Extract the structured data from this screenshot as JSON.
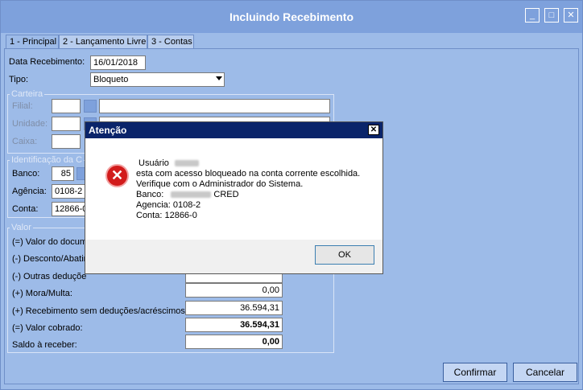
{
  "window": {
    "title": "Incluindo Recebimento",
    "minimize": "_",
    "maximize": "□",
    "close": "✕"
  },
  "tabs": [
    {
      "label": "1 - Principal"
    },
    {
      "label": "2 - Lançamento Livre"
    },
    {
      "label": "3 - Contas"
    }
  ],
  "form": {
    "data_recebimento_label": "Data Recebimento:",
    "data_recebimento_value": "16/01/2018",
    "tipo_label": "Tipo:",
    "tipo_value": "Bloqueto"
  },
  "carteira": {
    "legend": "Carteira",
    "filial_label": "Filial:",
    "unidade_label": "Unidade:",
    "caixa_label": "Caixa:"
  },
  "identificacao": {
    "legend": "Identificação da C",
    "banco_label": "Banco:",
    "banco_value": "85",
    "agencia_label": "Agência:",
    "agencia_value": "0108-2",
    "conta_label": "Conta:",
    "conta_value": "12866-0"
  },
  "valor": {
    "legend": "Valor",
    "rows": [
      {
        "label": "(=) Valor do docum",
        "value": ""
      },
      {
        "label": "(-) Desconto/Abatir",
        "value": ""
      },
      {
        "label": "(-) Outras deduçõe",
        "value": ""
      },
      {
        "label": "(+) Mora/Multa:",
        "value": "0,00"
      },
      {
        "label": "(+) Recebimento sem deduções/acréscimos:",
        "value": "36.594,31"
      },
      {
        "label": "(=) Valor cobrado:",
        "value": "36.594,31"
      },
      {
        "label": "Saldo à receber:",
        "value": "0,00"
      }
    ]
  },
  "buttons": {
    "confirmar": "Confirmar",
    "cancelar": "Cancelar"
  },
  "dialog": {
    "title": "Atenção",
    "close": "✕",
    "icon": "error-icon",
    "line1_prefix": "Usuário",
    "line2": "esta com acesso bloqueado na conta corrente escolhida.",
    "line3": "Verifique com o Administrador do Sistema.",
    "line4_prefix": "Banco:",
    "line4_suffix": "CRED",
    "line5": "Agencia:  0108-2",
    "line6": "Conta: 12866-0",
    "ok": "OK"
  },
  "colors": {
    "window_bg": "#9dbbe8",
    "titlebar": "#7ea1dc",
    "dialog_title": "#0a246a",
    "error_red": "#d21b1b"
  }
}
